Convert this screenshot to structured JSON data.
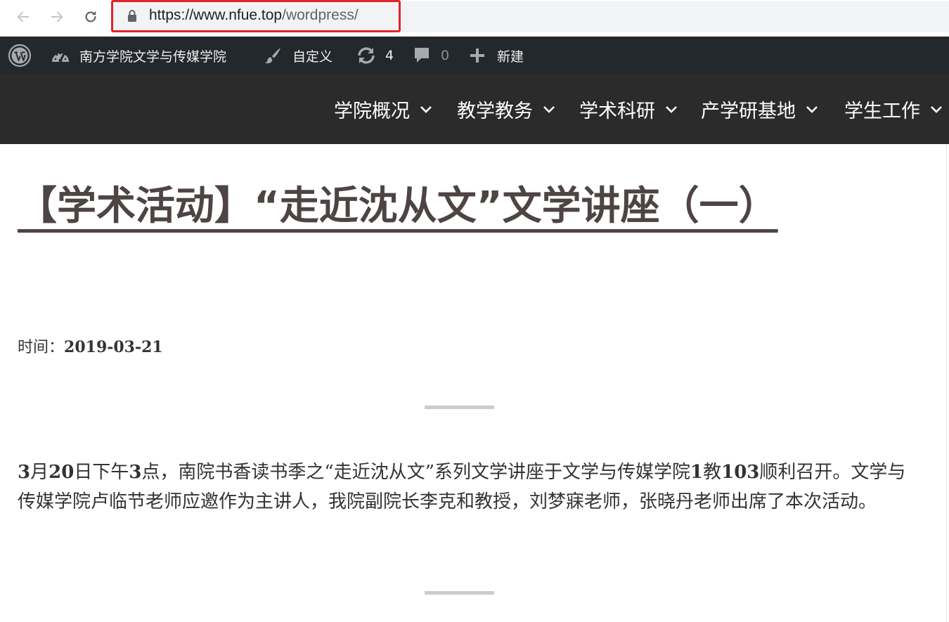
{
  "browser": {
    "url_host": "https://www.nfue.top",
    "url_path": "/wordpress/"
  },
  "adminbar": {
    "site_name": "南方学院文学与传媒学院",
    "customize": "自定义",
    "updates_count": "4",
    "comments_count": "0",
    "new_label": "新建"
  },
  "menu": [
    {
      "label": "学院概况"
    },
    {
      "label": "教学教务"
    },
    {
      "label": "学术科研"
    },
    {
      "label": "产学研基地"
    },
    {
      "label": "学生工作"
    }
  ],
  "post": {
    "title": "【学术活动】“走近沈从文”文学讲座（一）",
    "meta_label": "时间：",
    "meta_date": "2019-03-21",
    "body": {
      "b1": "3",
      "t1": "月",
      "b2": "20",
      "t2": "日下午",
      "b3": "3",
      "t3": "点，南院书香读书季之“走近沈从文”系列文学讲座于文学与传媒学院",
      "b4": "1",
      "t4": "教",
      "b5": "103",
      "t5": "顺利召开。文学与传媒学院卢临节老师应邀作为主讲人，我院副院长李克和教授，刘梦寐老师，张晓丹老师出席了本次活动。"
    }
  },
  "colors": {
    "adminbar_bg": "#23282d",
    "header_bg": "#2b2b2b",
    "title_color": "#4d4443",
    "url_highlight": "#e0242b"
  }
}
